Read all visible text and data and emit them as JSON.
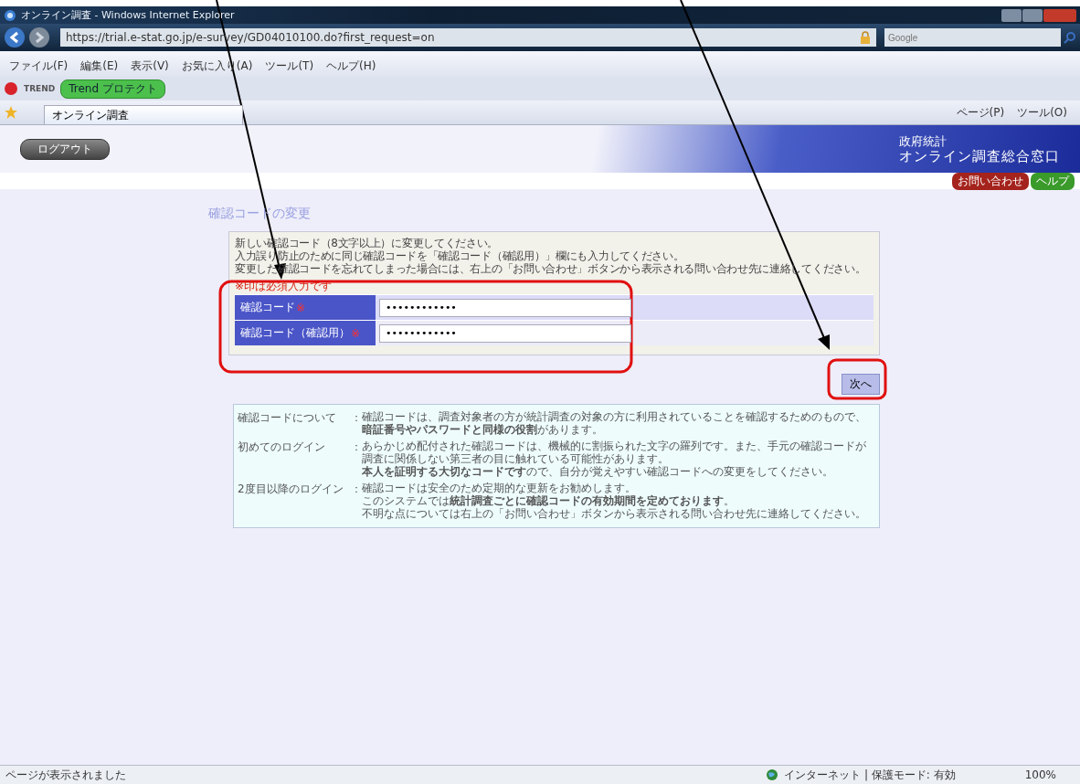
{
  "window": {
    "title": "オンライン調査 - Windows Internet Explorer"
  },
  "address_bar": {
    "url": "https://trial.e-stat.go.jp/e-survey/GD04010100.do?first_request=on",
    "search_placeholder": "Google"
  },
  "menu_bar": [
    "ファイル(F)",
    "編集(E)",
    "表示(V)",
    "お気に入り(A)",
    "ツール(T)",
    "ヘルプ(H)"
  ],
  "toolbar": {
    "brand": "TREND",
    "protect_button": "Trend プロテクト"
  },
  "tabs": [
    {
      "label": "オンライン調査",
      "selected": true
    }
  ],
  "command_bar": [
    "ページ(P)",
    "ツール(O)"
  ],
  "header": {
    "logout": "ログアウト",
    "site_title": [
      "政府統計",
      "オンライン調査総合窓口"
    ],
    "contact": "お問い合わせ",
    "help": "ヘルプ"
  },
  "page": {
    "heading": "確認コードの変更",
    "instructions": [
      "新しい確認コード（8文字以上）に変更してください。",
      "入力誤り防止のために同じ確認コードを「確認コード（確認用）」欄にも入力してください。",
      "変更した確認コードを忘れてしまった場合には、右上の「お問い合わせ」ボタンから表示される問い合わせ先に連絡してください。"
    ],
    "required_note": "※印は必須入力です",
    "fields": [
      {
        "label": "確認コード",
        "required_mark": "※",
        "value": "••••••••••••"
      },
      {
        "label": "確認コード（確認用）",
        "required_mark": "※",
        "value": "••••••••••••"
      }
    ],
    "next_button": "次へ",
    "notes": [
      {
        "term": "確認コードについて",
        "separator": "：",
        "paragraphs": [
          "確認コードは、調査対象者の方が統計調査の対象の方に利用されていることを確認するためのもので、**暗証番号やパスワードと同様の役割**があります。"
        ]
      },
      {
        "term": "初めてのログイン",
        "separator": "：",
        "paragraphs": [
          "あらかじめ配付された確認コードは、機械的に割振られた文字の羅列です。また、手元の確認コードが調査に関係しない第三者の目に触れている可能性があります。",
          "**本人を証明する大切なコードです**ので、自分が覚えやすい確認コードへの変更をしてください。"
        ]
      },
      {
        "term": "2度目以降のログイン",
        "separator": "：",
        "paragraphs": [
          "確認コードは安全のため定期的な更新をお勧めします。",
          "このシステムでは**統計調査ごとに確認コードの有効期間を定めております**。",
          "不明な点については右上の「お問い合わせ」ボタンから表示される問い合わせ先に連絡してください。"
        ]
      }
    ]
  },
  "status_bar": {
    "message": "ページが表示されました",
    "zone": "インターネット | 保護モード: 有効",
    "zoom": "100%"
  }
}
